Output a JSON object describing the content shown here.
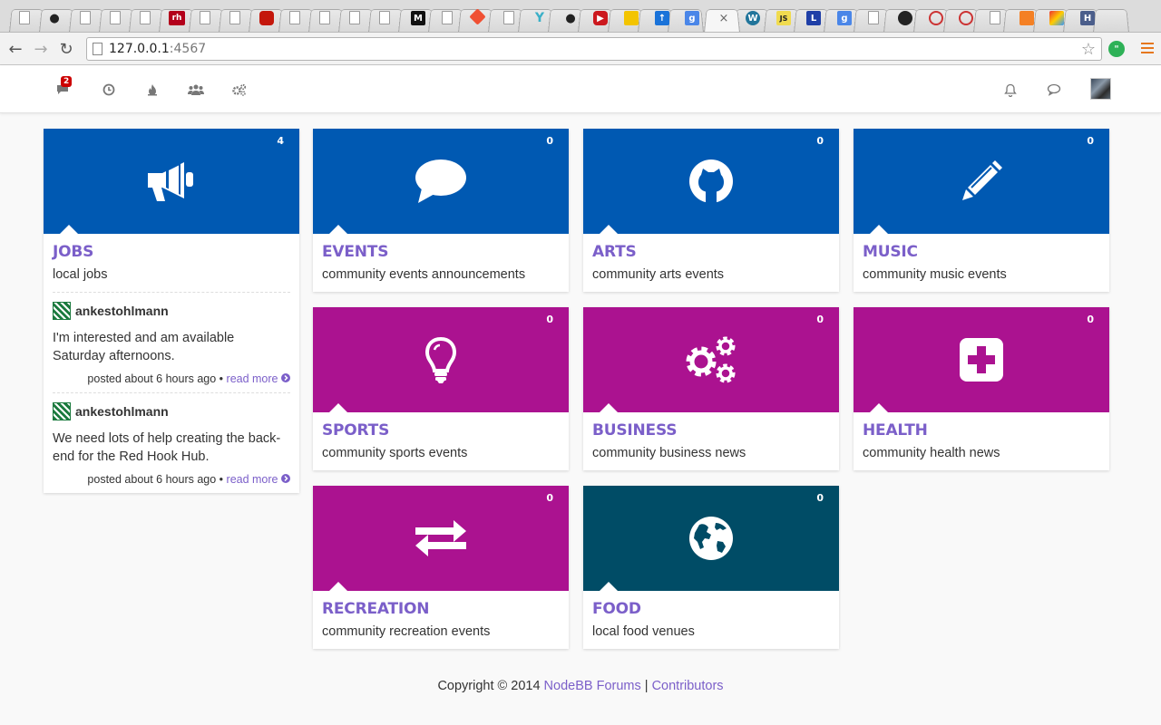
{
  "browser": {
    "url_host": "127.0.0.1",
    "url_port": ":4567",
    "tab_close_glyph": "×"
  },
  "header": {
    "unread_badge": "2",
    "nav_icons": [
      "unread-icon",
      "recent-icon",
      "popular-icon",
      "users-icon",
      "admin-icon"
    ],
    "right_icons": [
      "notifications-icon",
      "chat-icon",
      "user-avatar"
    ]
  },
  "colors": {
    "blue": "#0059b2",
    "magenta": "#ab1290",
    "teal": "#004c66",
    "link": "#7b5fc9"
  },
  "categories": [
    {
      "title": "JOBS",
      "desc": "local jobs",
      "count": "4",
      "icon": "bullhorn-icon"
    },
    {
      "title": "EVENTS",
      "desc": "community events announcements",
      "count": "0",
      "icon": "comment-icon"
    },
    {
      "title": "ARTS",
      "desc": "community arts events",
      "count": "0",
      "icon": "github-icon"
    },
    {
      "title": "MUSIC",
      "desc": "community music events",
      "count": "0",
      "icon": "pencil-icon"
    },
    {
      "title": "SPORTS",
      "desc": "community sports events",
      "count": "0",
      "icon": "lightbulb-icon"
    },
    {
      "title": "BUSINESS",
      "desc": "community business news",
      "count": "0",
      "icon": "cogs-icon"
    },
    {
      "title": "HEALTH",
      "desc": "community health news",
      "count": "0",
      "icon": "plus-square-icon"
    },
    {
      "title": "RECREATION",
      "desc": "community recreation events",
      "count": "0",
      "icon": "exchange-icon"
    },
    {
      "title": "FOOD",
      "desc": "local food venues",
      "count": "0",
      "icon": "globe-icon"
    }
  ],
  "jobs_posts": [
    {
      "author": "ankestohlmann",
      "text": "I'm interested and am available Saturday afternoons.",
      "time": "posted about 6 hours ago",
      "sep": " • ",
      "link": "read more"
    },
    {
      "author": "ankestohlmann",
      "text": "We need lots of help creating the back-end for the Red Hook Hub.",
      "time": "posted about 6 hours ago",
      "sep": " • ",
      "link": "read more"
    }
  ],
  "footer": {
    "copyright": "Copyright © 2014 ",
    "forum_link": "NodeBB Forums",
    "sep": " | ",
    "contributors_link": "Contributors"
  }
}
